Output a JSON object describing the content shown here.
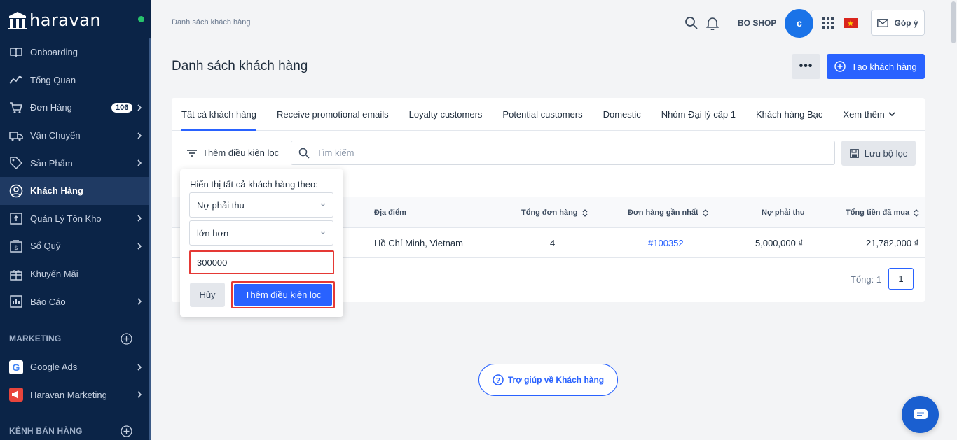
{
  "app": {
    "brand": "haravan",
    "breadcrumb": "Danh sách khách hàng",
    "shop_name": "BO SHOP",
    "avatar_initial": "c",
    "feedback_label": "Góp ý",
    "page_title": "Danh sách khách hàng",
    "more_label": "•••",
    "create_label": "Tạo khách hàng"
  },
  "sidebar": {
    "items": [
      {
        "label": "Onboarding",
        "icon": "book-icon"
      },
      {
        "label": "Tổng Quan",
        "icon": "chart-line-icon"
      },
      {
        "label": "Đơn Hàng",
        "icon": "cart-icon",
        "badge": "106"
      },
      {
        "label": "Vận Chuyển",
        "icon": "truck-icon"
      },
      {
        "label": "Sản Phẩm",
        "icon": "tag-icon"
      },
      {
        "label": "Khách Hàng",
        "icon": "user-circle-icon",
        "active": true
      },
      {
        "label": "Quản Lý Tồn Kho",
        "icon": "inventory-icon"
      },
      {
        "label": "Sổ Quỹ",
        "icon": "cashbook-icon"
      },
      {
        "label": "Khuyến Mãi",
        "icon": "gift-icon"
      },
      {
        "label": "Báo Cáo",
        "icon": "report-icon"
      }
    ],
    "marketing_title": "MARKETING",
    "marketing_items": [
      {
        "label": "Google Ads",
        "icon": "google-icon"
      },
      {
        "label": "Haravan Marketing",
        "icon": "megaphone-icon"
      }
    ],
    "sales_title": "KÊNH BÁN HÀNG"
  },
  "tabs": [
    {
      "label": "Tất cả khách hàng",
      "active": true
    },
    {
      "label": "Receive promotional emails"
    },
    {
      "label": "Loyalty customers"
    },
    {
      "label": "Potential customers"
    },
    {
      "label": "Domestic"
    },
    {
      "label": "Nhóm Đại lý cấp 1"
    },
    {
      "label": "Khách hàng Bạc"
    },
    {
      "label": "Xem thêm"
    }
  ],
  "toolbar": {
    "filter_label": "Thêm điều kiện lọc",
    "search_placeholder": "Tìm kiếm",
    "save_filter_label": "Lưu bộ lọc"
  },
  "table": {
    "columns": [
      "Địa điểm",
      "Tổng đơn hàng",
      "Đơn hàng gần nhất",
      "Nợ phải thu",
      "Tổng tiền đã mua"
    ],
    "rows": [
      {
        "location": "Hồ Chí Minh, Vietnam",
        "orders": "4",
        "last_order": "#100352",
        "debt": "5,000,000 ₫",
        "total_spent": "21,782,000 ₫"
      }
    ],
    "total_label": "Tổng: 1",
    "page": "1"
  },
  "popover": {
    "label": "Hiển thị tất cả khách hàng theo:",
    "field_value": "Nợ phải thu",
    "operator_value": "lớn hơn",
    "input_value": "300000",
    "cancel_label": "Hủy",
    "add_label": "Thêm điều kiện lọc"
  },
  "help_label": "Trợ giúp về Khách hàng",
  "colors": {
    "sidebar_bg": "#0b2447",
    "primary": "#2962ff",
    "highlight": "#e53935"
  }
}
